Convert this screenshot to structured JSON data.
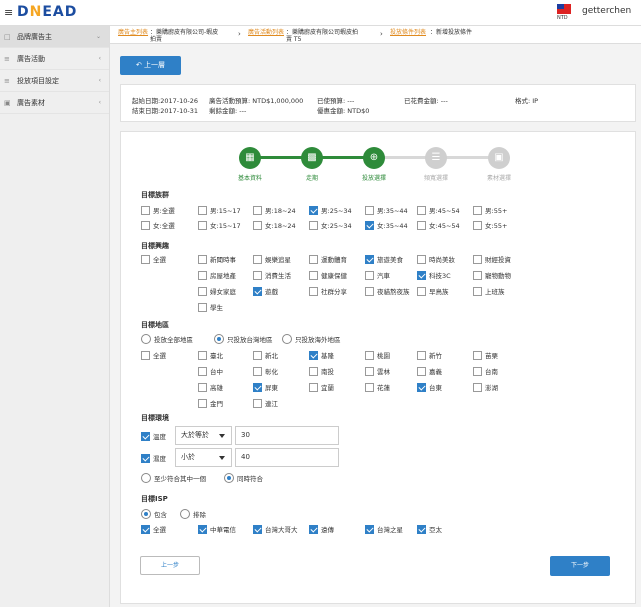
{
  "header": {
    "logo": "DNEAD",
    "locale": "NTD",
    "username": "getterchen"
  },
  "sidebar": {
    "items": [
      {
        "label": "品牌廣告主",
        "icon": "briefcase-icon"
      },
      {
        "label": "廣告活動",
        "icon": "list-icon"
      },
      {
        "label": "投放項目設定",
        "icon": "settings-icon"
      },
      {
        "label": "廣告素材",
        "icon": "image-icon"
      }
    ]
  },
  "breadcrumb": {
    "link1": "廣告主列表",
    "text1a": "：樂購廚皮有限公司-蝦皮",
    "text1b": "拍賣",
    "link2": "廣告活動列表",
    "text2a": "：樂購廚皮有限公司蝦皮拍",
    "text2b": "賣 T5",
    "link3": "投放條件列表",
    "text3": "：新增投放條件"
  },
  "back_button": "上一層",
  "info": {
    "start_date": "起始日期:2017-10-26",
    "end_date": "結束日期:2017-10-31",
    "budget": "廣告活動預算: NTD$1,000,000",
    "remaining": "剩餘金額: ---",
    "used_budget": "已使預算: ---",
    "discount": "優惠金額: NTD$0",
    "spent": "已花費金額: ---",
    "format": "格式: IP"
  },
  "steps": [
    {
      "label": "基本資料",
      "done": true,
      "icon": "table-icon"
    },
    {
      "label": "走期",
      "done": true,
      "icon": "calendar-icon"
    },
    {
      "label": "投放選擇",
      "done": true,
      "icon": "plus-icon"
    },
    {
      "label": "頻寬選擇",
      "done": false,
      "icon": "database-icon"
    },
    {
      "label": "素材選擇",
      "done": false,
      "icon": "image-icon"
    }
  ],
  "colors": {
    "primary": "#2f80c7",
    "success": "#2e8b3a",
    "link": "#e08a1e"
  },
  "audience": {
    "title": "目標族群",
    "row1": [
      {
        "label": "男:全選",
        "checked": false
      },
      {
        "label": "男:15~17",
        "checked": false
      },
      {
        "label": "男:18~24",
        "checked": false
      },
      {
        "label": "男:25~34",
        "checked": true
      },
      {
        "label": "男:35~44",
        "checked": false
      },
      {
        "label": "男:45~54",
        "checked": false
      },
      {
        "label": "男:55+",
        "checked": false
      }
    ],
    "row2": [
      {
        "label": "女:全選",
        "checked": false
      },
      {
        "label": "女:15~17",
        "checked": false
      },
      {
        "label": "女:18~24",
        "checked": false
      },
      {
        "label": "女:25~34",
        "checked": false
      },
      {
        "label": "女:35~44",
        "checked": true
      },
      {
        "label": "女:45~54",
        "checked": false
      },
      {
        "label": "女:55+",
        "checked": false
      }
    ]
  },
  "interests": {
    "title": "目標興趣",
    "all": {
      "label": "全選",
      "checked": false
    },
    "items": [
      {
        "label": "新聞時事",
        "checked": false
      },
      {
        "label": "娛樂追星",
        "checked": false
      },
      {
        "label": "運動體育",
        "checked": false
      },
      {
        "label": "旅遊美食",
        "checked": true
      },
      {
        "label": "時尚美妝",
        "checked": false
      },
      {
        "label": "財經投資",
        "checked": false
      },
      {
        "label": "房屋地產",
        "checked": false
      },
      {
        "label": "消費生活",
        "checked": false
      },
      {
        "label": "健康保健",
        "checked": false
      },
      {
        "label": "汽車",
        "checked": false
      },
      {
        "label": "科技3C",
        "checked": true
      },
      {
        "label": "寵物動物",
        "checked": false
      },
      {
        "label": "婦女家庭",
        "checked": false
      },
      {
        "label": "遊戲",
        "checked": true
      },
      {
        "label": "社群分享",
        "checked": false
      },
      {
        "label": "夜貓熬夜族",
        "checked": false
      },
      {
        "label": "早鳥族",
        "checked": false
      },
      {
        "label": "上班族",
        "checked": false
      },
      {
        "label": "學生",
        "checked": false
      }
    ]
  },
  "region": {
    "title": "目標地區",
    "scope": [
      {
        "label": "投放全部地區",
        "selected": false
      },
      {
        "label": "只投放台灣地區",
        "selected": true
      },
      {
        "label": "只投放海外地區",
        "selected": false
      }
    ],
    "all": {
      "label": "全選",
      "checked": false
    },
    "items": [
      {
        "label": "臺北",
        "checked": false
      },
      {
        "label": "新北",
        "checked": false
      },
      {
        "label": "基隆",
        "checked": true
      },
      {
        "label": "桃園",
        "checked": false
      },
      {
        "label": "新竹",
        "checked": false
      },
      {
        "label": "苗栗",
        "checked": false
      },
      {
        "label": "台中",
        "checked": false
      },
      {
        "label": "彰化",
        "checked": false
      },
      {
        "label": "南投",
        "checked": false
      },
      {
        "label": "雲林",
        "checked": false
      },
      {
        "label": "嘉義",
        "checked": false
      },
      {
        "label": "台南",
        "checked": false
      },
      {
        "label": "高雄",
        "checked": false
      },
      {
        "label": "屏東",
        "checked": true
      },
      {
        "label": "宜蘭",
        "checked": false
      },
      {
        "label": "花蓮",
        "checked": false
      },
      {
        "label": "台東",
        "checked": true
      },
      {
        "label": "澎湖",
        "checked": false
      },
      {
        "label": "金門",
        "checked": false
      },
      {
        "label": "連江",
        "checked": false
      }
    ]
  },
  "environment": {
    "title": "目標環境",
    "temperature": {
      "label": "溫度",
      "checked": true,
      "operator": "大於等於",
      "value": "30"
    },
    "humidity": {
      "label": "濕度",
      "checked": true,
      "operator": "小於",
      "value": "40"
    },
    "match": [
      {
        "label": "至少符合其中一個",
        "selected": false
      },
      {
        "label": "同時符合",
        "selected": true
      }
    ]
  },
  "isp": {
    "title": "目標ISP",
    "mode": [
      {
        "label": "包含",
        "selected": true
      },
      {
        "label": "排除",
        "selected": false
      }
    ],
    "items": [
      {
        "label": "全選",
        "checked": true
      },
      {
        "label": "中華電信",
        "checked": true
      },
      {
        "label": "台灣大哥大",
        "checked": true
      },
      {
        "label": "遠傳",
        "checked": true
      },
      {
        "label": "台灣之星",
        "checked": true
      },
      {
        "label": "亞太",
        "checked": true
      }
    ]
  },
  "footer": {
    "prev": "上一步",
    "next": "下一步"
  }
}
